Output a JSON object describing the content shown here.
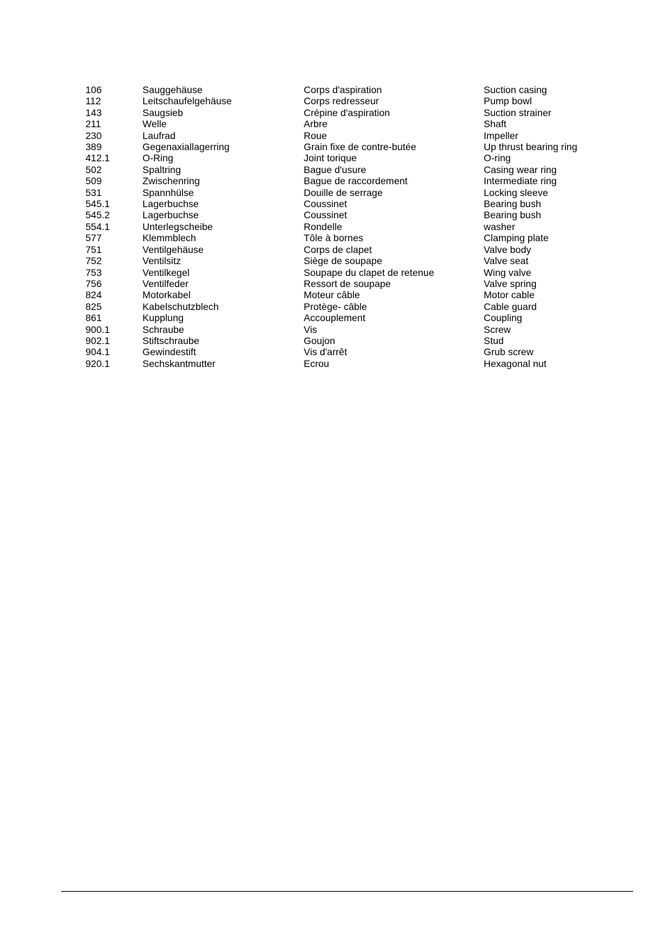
{
  "parts_list": {
    "rows": [
      {
        "no": "106",
        "de": "Sauggehäuse",
        "fr": "Corps d'aspiration",
        "en": "Suction casing"
      },
      {
        "no": "112",
        "de": "Leitschaufelgehäuse",
        "fr": "Corps redresseur",
        "en": "Pump bowl"
      },
      {
        "no": "143",
        "de": "Saugsieb",
        "fr": "Crépine d'aspiration",
        "en": "Suction strainer"
      },
      {
        "no": "211",
        "de": "Welle",
        "fr": "Arbre",
        "en": "Shaft"
      },
      {
        "no": "230",
        "de": "Laufrad",
        "fr": "Roue",
        "en": "Impeller"
      },
      {
        "no": "389",
        "de": "Gegenaxiallagerring",
        "fr": "Grain fixe de contre-butée",
        "en": "Up thrust bearing ring"
      },
      {
        "no": "412.1",
        "de": "O-Ring",
        "fr": "Joint torique",
        "en": "O-ring"
      },
      {
        "no": "502",
        "de": "Spaltring",
        "fr": "Bague d'usure",
        "en": "Casing wear ring"
      },
      {
        "no": "509",
        "de": "Zwischenring",
        "fr": "Bague de raccordement",
        "en": "Intermediate ring"
      },
      {
        "no": "531",
        "de": "Spannhülse",
        "fr": "Douille de serrage",
        "en": "Locking sleeve"
      },
      {
        "no": "545.1",
        "de": "Lagerbuchse",
        "fr": "Coussinet",
        "en": "Bearing bush"
      },
      {
        "no": "545.2",
        "de": "Lagerbuchse",
        "fr": "Coussinet",
        "en": "Bearing bush"
      },
      {
        "no": "554.1",
        "de": "Unterlegscheibe",
        "fr": "Rondelle",
        "en": "washer"
      },
      {
        "no": "577",
        "de": "Klemmblech",
        "fr": "Tôle à bornes",
        "en": "Clamping plate"
      },
      {
        "no": "751",
        "de": "Ventilgehäuse",
        "fr": "Corps de clapet",
        "en": "Valve body"
      },
      {
        "no": "752",
        "de": "Ventilsitz",
        "fr": "Siège de soupape",
        "en": "Valve seat"
      },
      {
        "no": "753",
        "de": "Ventilkegel",
        "fr": "Soupape du clapet de retenue",
        "en": "Wing valve"
      },
      {
        "no": "756",
        "de": "Ventilfeder",
        "fr": "Ressort de soupape",
        "en": "Valve spring"
      },
      {
        "no": "824",
        "de": "Motorkabel",
        "fr": "Moteur câble",
        "en": "Motor cable"
      },
      {
        "no": "825",
        "de": "Kabelschutzblech",
        "fr": "Protège- câble",
        "en": "Cable guard"
      },
      {
        "no": "861",
        "de": "Kupplung",
        "fr": "Accouplement",
        "en": "Coupling"
      },
      {
        "no": "900.1",
        "de": "Schraube",
        "fr": "Vis",
        "en": "Screw"
      },
      {
        "no": "902.1",
        "de": "Stiftschraube",
        "fr": "Goujon",
        "en": "Stud"
      },
      {
        "no": "904.1",
        "de": "Gewindestift",
        "fr": "Vis d'arrêt",
        "en": "Grub screw"
      },
      {
        "no": "920.1",
        "de": "Sechskantmutter",
        "fr": "Ecrou",
        "en": "Hexagonal nut"
      }
    ]
  }
}
